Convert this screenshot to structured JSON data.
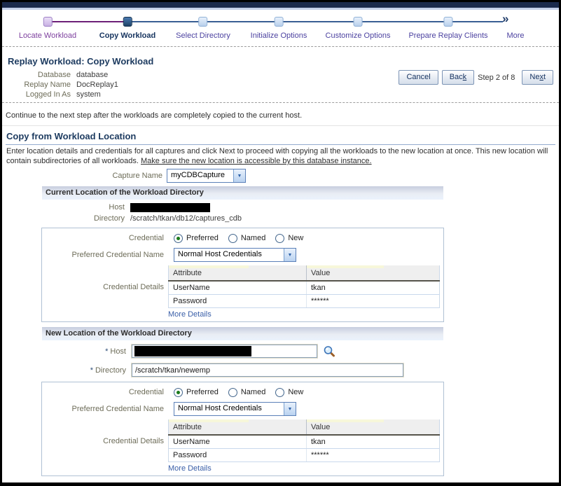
{
  "train": {
    "steps": [
      {
        "label": "Locate Workload",
        "state": "visited"
      },
      {
        "label": "Copy Workload",
        "state": "current"
      },
      {
        "label": "Select Directory",
        "state": "future"
      },
      {
        "label": "Initialize Options",
        "state": "future"
      },
      {
        "label": "Customize Options",
        "state": "future"
      },
      {
        "label": "Prepare Replay Clients",
        "state": "future"
      },
      {
        "label": "More",
        "state": "more"
      }
    ]
  },
  "header": {
    "title": "Replay Workload: Copy Workload",
    "info": [
      {
        "label": "Database",
        "value": "database"
      },
      {
        "label": "Replay Name",
        "value": "DocReplay1"
      },
      {
        "label": "Logged In As",
        "value": "system"
      }
    ],
    "buttons": {
      "cancel": "Cancel",
      "back_pre": "Bac",
      "back_key": "k",
      "back_post": "",
      "step_text": "Step 2 of 8",
      "next_pre": "Ne",
      "next_key": "x",
      "next_post": "t"
    }
  },
  "notice": "Continue to the next step after the workloads are completely copied to the current host.",
  "section": {
    "heading": "Copy from Workload Location",
    "description": "Enter location details and credentials for all captures and click Next to proceed with copying all the workloads to the new location at once. This new location will contain subdirectories of all workloads.",
    "description_underlined": "Make sure the new location is accessible by this database instance.",
    "capture_name_label": "Capture Name",
    "capture_name_value": "myCDBCapture"
  },
  "current_location": {
    "heading": "Current Location of the Workload Directory",
    "host_label": "Host",
    "directory_label": "Directory",
    "directory_value": "/scratch/tkan/db12/captures_cdb"
  },
  "new_location": {
    "heading": "New Location of the Workload Directory",
    "required_marker": "*",
    "host_label": "Host",
    "directory_label": "Directory",
    "directory_value": "/scratch/tkan/newemp"
  },
  "credential_form": {
    "credential_label": "Credential",
    "options": [
      "Preferred",
      "Named",
      "New"
    ],
    "selected_option": "Preferred",
    "preferred_name_label": "Preferred Credential Name",
    "preferred_name_value": "Normal Host Credentials",
    "details_label": "Credential Details",
    "table": {
      "columns": [
        "Attribute",
        "Value"
      ],
      "rows": [
        [
          "UserName",
          "tkan"
        ],
        [
          "Password",
          "******"
        ]
      ]
    },
    "more_details_label": "More Details"
  },
  "colors": {
    "accent_navy": "#1b2a4c",
    "train_visited_line": "#6d2077",
    "train_future_line": "#3a5f93",
    "link_blue": "#3a5fa8",
    "radio_selected_green": "#1a7a1a"
  }
}
